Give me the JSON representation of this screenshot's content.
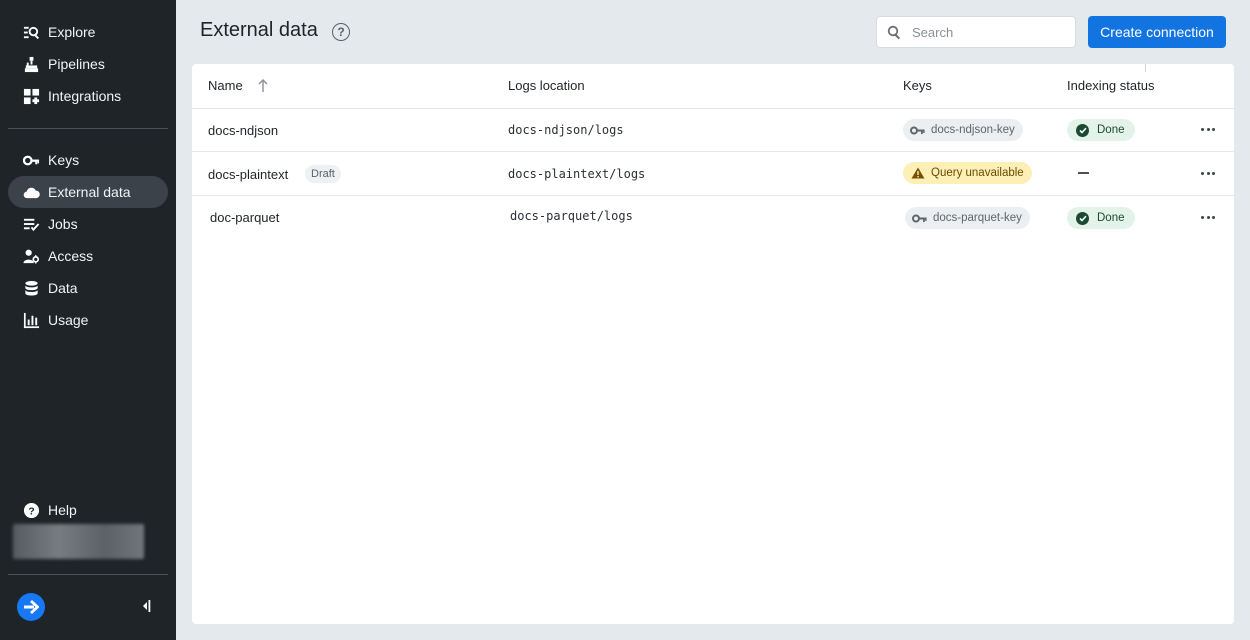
{
  "sidebar": {
    "primary_items": [
      {
        "label": "Explore",
        "icon": "explore-icon"
      },
      {
        "label": "Pipelines",
        "icon": "pipeline-icon"
      },
      {
        "label": "Integrations",
        "icon": "grid-icon"
      }
    ],
    "secondary_items": [
      {
        "label": "Keys",
        "icon": "key-icon"
      },
      {
        "label": "External data",
        "icon": "cloud-icon",
        "active": true
      },
      {
        "label": "Jobs",
        "icon": "jobs-icon"
      },
      {
        "label": "Access",
        "icon": "access-icon"
      },
      {
        "label": "Data",
        "icon": "database-icon"
      },
      {
        "label": "Usage",
        "icon": "bar-chart-icon"
      }
    ],
    "help_label": "Help",
    "help_icon": "help-circle-icon"
  },
  "header": {
    "title": "External data",
    "search_placeholder": "Search",
    "create_button_label": "Create connection"
  },
  "table": {
    "columns": {
      "name": "Name",
      "logs_location": "Logs location",
      "keys": "Keys",
      "indexing_status": "Indexing status"
    },
    "sort": "ascending",
    "rows": [
      {
        "name": "docs-ndjson",
        "badge": "",
        "logs_location": "docs-ndjson/logs",
        "key": "docs-ndjson-key",
        "status": "Done"
      },
      {
        "name": "docs-plaintext",
        "badge": "Draft",
        "logs_location": "docs-plaintext/logs",
        "key_warning": "Query unavailable",
        "status": ""
      },
      {
        "name": "doc-parquet",
        "badge": "",
        "logs_location": "docs-parquet/logs",
        "key": "docs-parquet-key",
        "status": "Done"
      }
    ]
  },
  "colors": {
    "sidebar_bg": "#1f2429",
    "accent": "#1274e0",
    "done_bg": "#e4f3ea",
    "warning_bg": "#fdf0b6"
  }
}
